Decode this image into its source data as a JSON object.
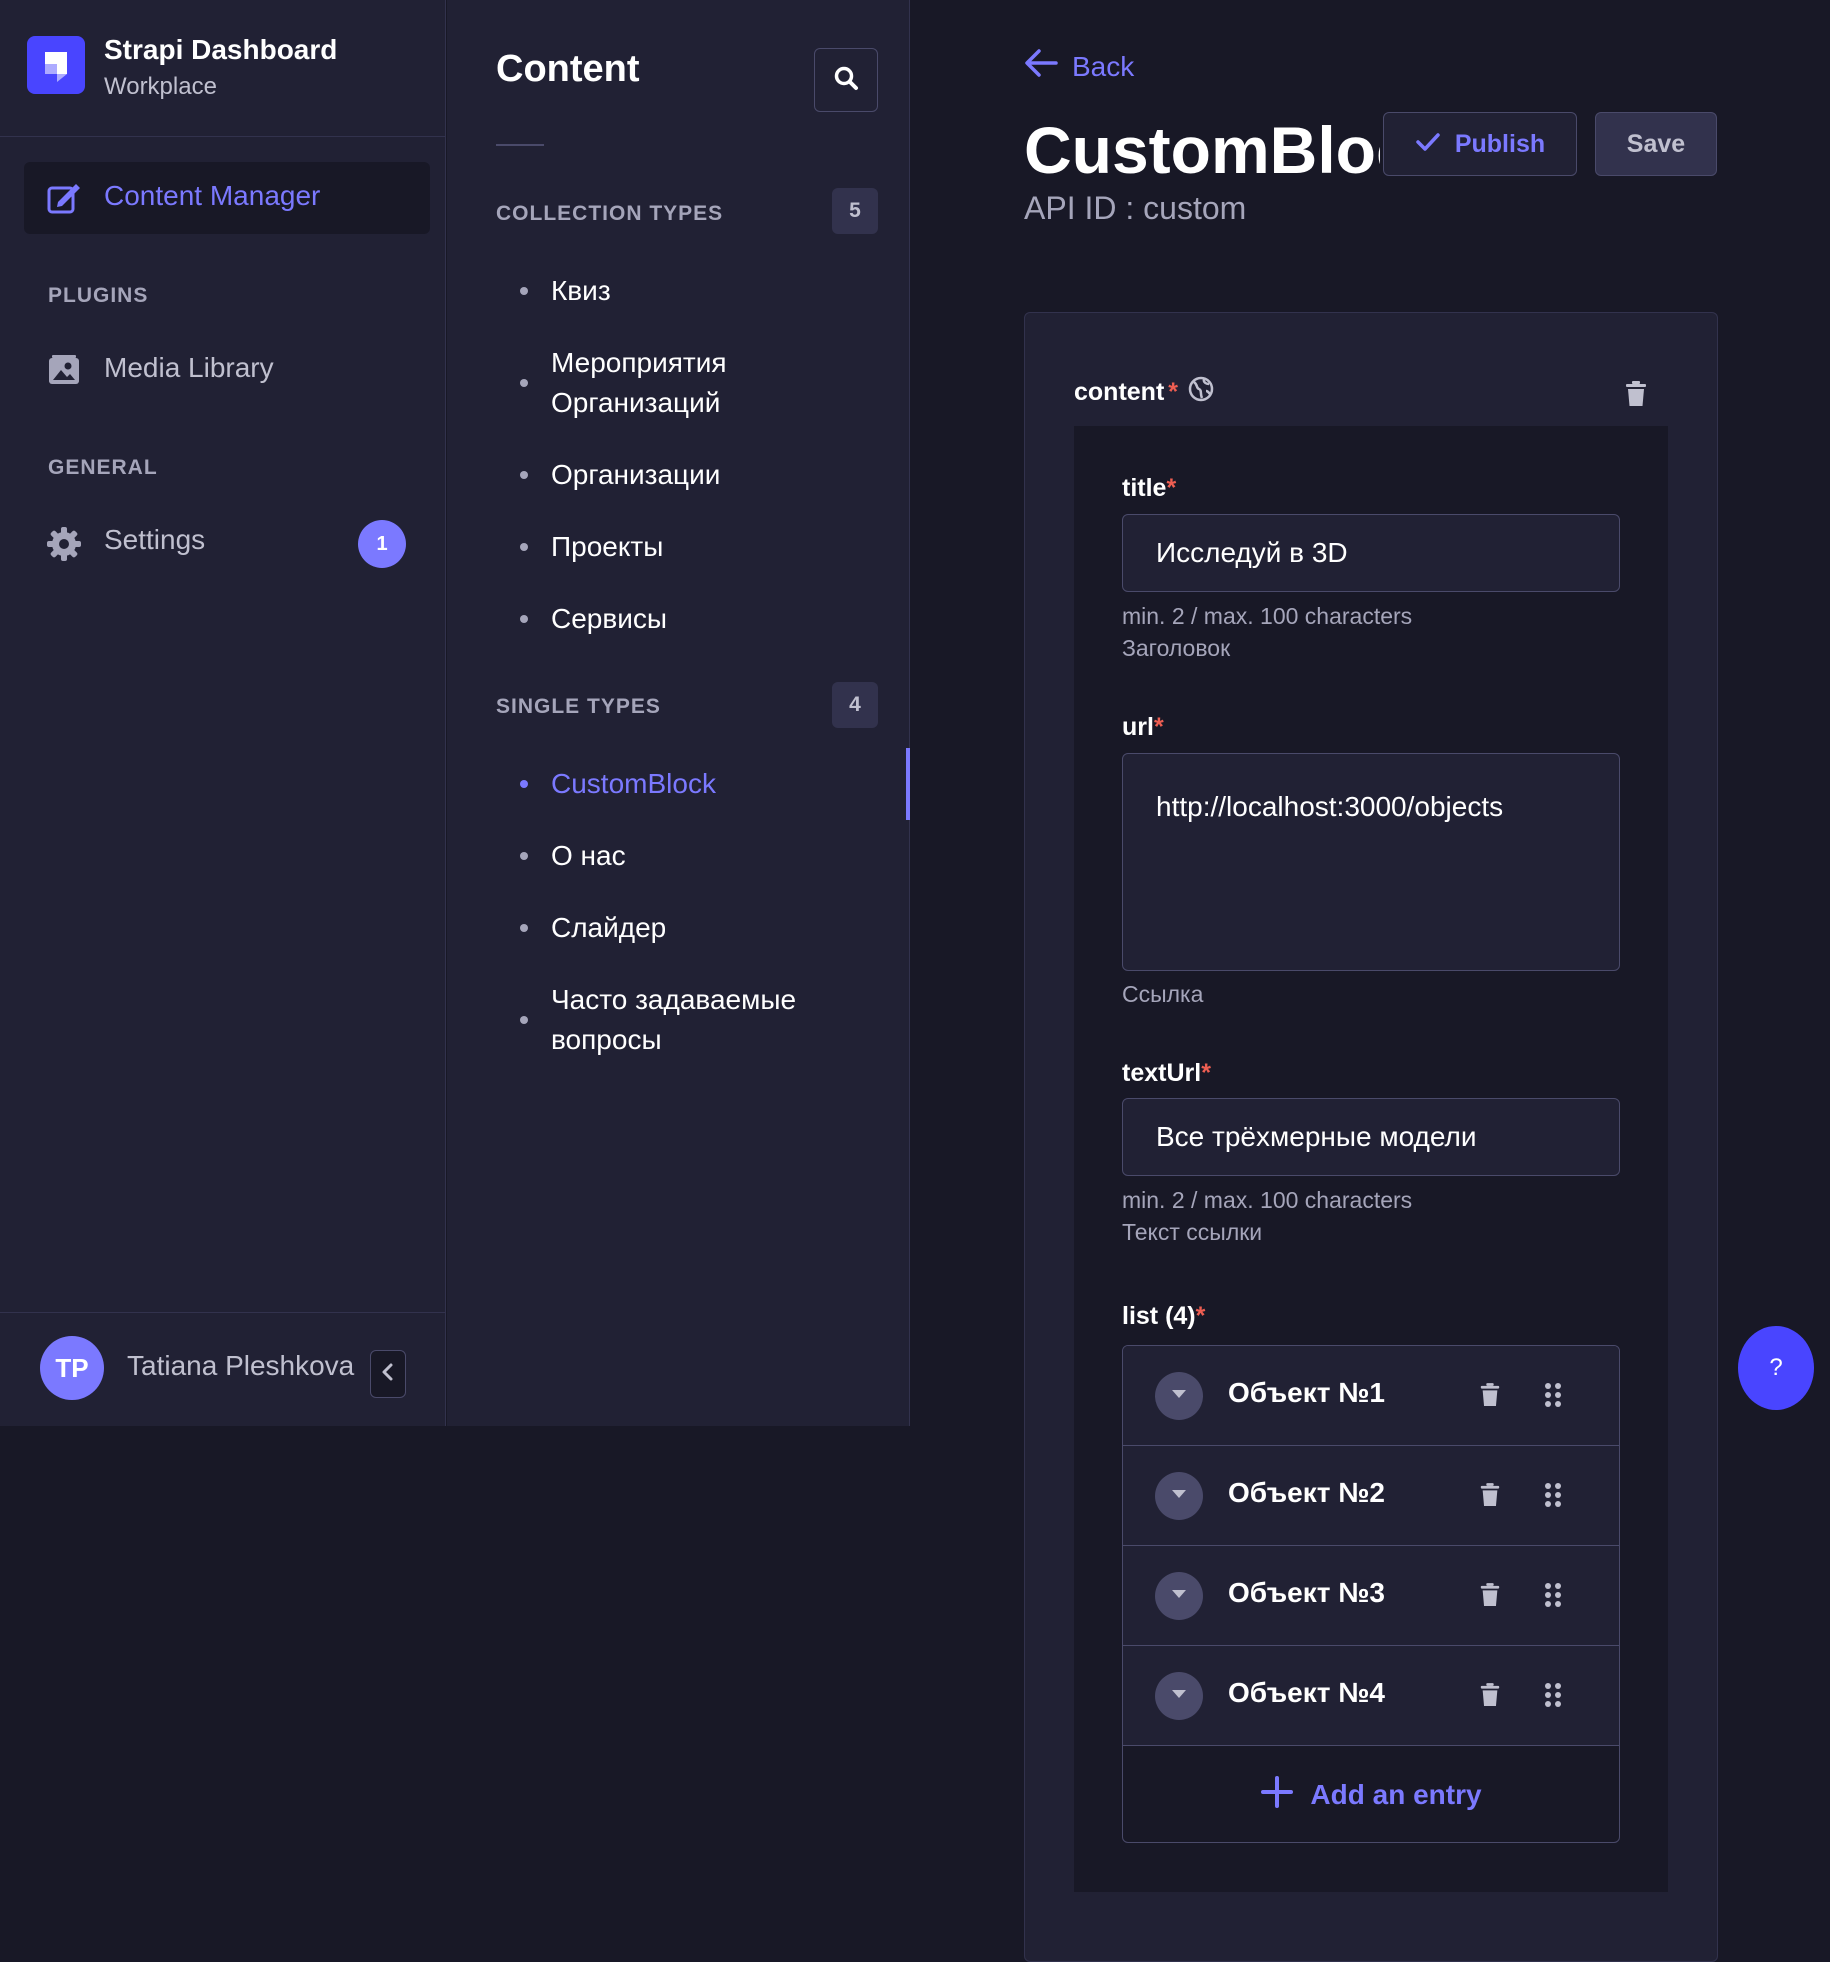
{
  "brand": {
    "title": "Strapi Dashboard",
    "subtitle": "Workplace"
  },
  "nav": {
    "content_manager": "Content Manager",
    "plugins_label": "PLUGINS",
    "media_library": "Media Library",
    "general_label": "GENERAL",
    "settings": "Settings",
    "settings_badge": "1"
  },
  "user": {
    "initials": "TP",
    "name": "Tatiana Pleshkova"
  },
  "subnav": {
    "title": "Content",
    "collection_label": "COLLECTION TYPES",
    "collection_count": "5",
    "collection_items": [
      [
        "Квиз"
      ],
      [
        "Мероприятия",
        "Организаций"
      ],
      [
        "Организации"
      ],
      [
        "Проекты"
      ],
      [
        "Сервисы"
      ]
    ],
    "single_label": "SINGLE TYPES",
    "single_count": "4",
    "single_items": [
      [
        "CustomBlock"
      ],
      [
        "О нас"
      ],
      [
        "Слайдер"
      ],
      [
        "Часто задаваемые",
        "вопросы"
      ]
    ],
    "active_single": 0
  },
  "header": {
    "back": "Back",
    "title": "CustomBlock",
    "publish": "Publish",
    "save": "Save",
    "api_id": "API ID : custom"
  },
  "form": {
    "component_label": "content",
    "required_mark": "*",
    "title": {
      "label": "title",
      "value": "Исследуй в 3D",
      "limits": "min. 2 / max. 100 characters",
      "description": "Заголовок"
    },
    "url": {
      "label": "url",
      "value": "http://localhost:3000/objects",
      "description": "Ссылка"
    },
    "textUrl": {
      "label": "textUrl",
      "value": "Все трёхмерные модели",
      "limits": "min. 2 / max. 100 characters",
      "description": "Текст ссылки"
    },
    "list": {
      "label": "list (4)",
      "items": [
        "Объект №1",
        "Объект №2",
        "Объект №3",
        "Объект №4"
      ],
      "add_entry": "Add an entry"
    }
  },
  "help": "?",
  "colors": {
    "accent": "#7b79ff",
    "brand": "#4945ff",
    "required": "#ee5e52",
    "background": "#181826",
    "panel": "#212134"
  },
  "icons": [
    "strapi-logo-icon",
    "content-manager-icon",
    "media-library-icon",
    "gear-icon",
    "chevron-left-icon",
    "search-icon",
    "arrow-left-icon",
    "check-icon",
    "globe-icon",
    "trash-icon",
    "chevron-down-icon",
    "drag-handle-icon",
    "plus-icon"
  ]
}
